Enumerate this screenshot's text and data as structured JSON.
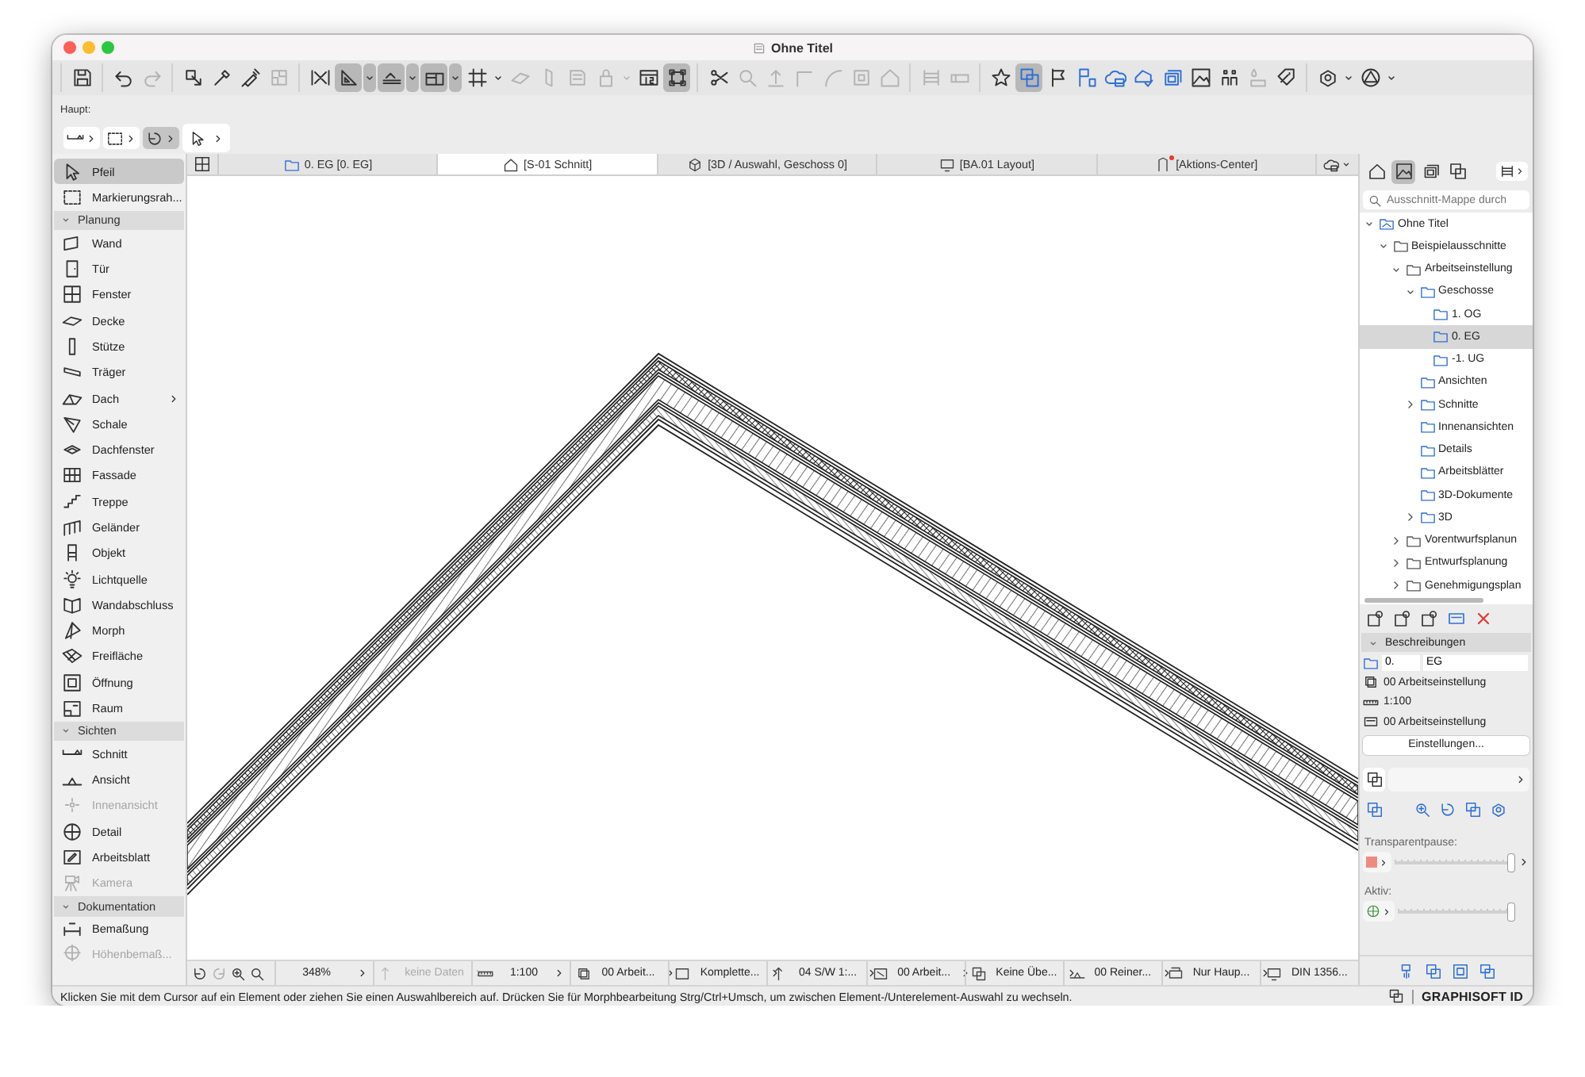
{
  "window": {
    "title": "Ohne Titel"
  },
  "toolbar": [
    {
      "buttons": [
        {
          "kind": "plain",
          "selected": false,
          "disabled": false
        }
      ]
    },
    {
      "buttons": [
        {
          "kind": "plain",
          "selected": false,
          "disabled": false
        },
        {
          "kind": "plain",
          "selected": false,
          "disabled": true
        }
      ]
    },
    {
      "buttons": [
        {
          "kind": "plain",
          "selected": false,
          "disabled": false
        },
        {
          "kind": "plain",
          "selected": false,
          "disabled": false
        },
        {
          "kind": "plain",
          "selected": false,
          "disabled": false
        },
        {
          "kind": "plain",
          "selected": false,
          "disabled": true
        }
      ]
    },
    {
      "buttons": [
        {
          "kind": "plain",
          "selected": false,
          "disabled": false
        },
        {
          "kind": "menu",
          "selected": true,
          "disabled": false
        },
        {
          "kind": "menu",
          "selected": true,
          "disabled": false
        },
        {
          "kind": "menu",
          "selected": true,
          "disabled": false
        },
        {
          "kind": "menu",
          "selected": false,
          "disabled": false
        },
        {
          "kind": "plain",
          "selected": false,
          "disabled": true
        },
        {
          "kind": "plain",
          "selected": false,
          "disabled": true
        },
        {
          "kind": "plain",
          "selected": false,
          "disabled": true
        },
        {
          "kind": "menu",
          "selected": false,
          "disabled": true
        },
        {
          "kind": "plain",
          "selected": false,
          "disabled": false
        },
        {
          "kind": "plain",
          "selected": true,
          "disabled": false
        }
      ]
    },
    {
      "buttons": [
        {
          "kind": "plain",
          "selected": false,
          "disabled": false
        },
        {
          "kind": "plain",
          "selected": false,
          "disabled": true
        },
        {
          "kind": "plain",
          "selected": false,
          "disabled": true
        },
        {
          "kind": "plain",
          "selected": false,
          "disabled": true
        },
        {
          "kind": "plain",
          "selected": false,
          "disabled": true
        },
        {
          "kind": "plain",
          "selected": false,
          "disabled": true
        },
        {
          "kind": "plain",
          "selected": false,
          "disabled": true
        }
      ]
    },
    {
      "buttons": [
        {
          "kind": "plain",
          "selected": false,
          "disabled": true
        },
        {
          "kind": "plain",
          "selected": false,
          "disabled": true
        }
      ]
    },
    {
      "buttons": [
        {
          "kind": "plain",
          "selected": false,
          "disabled": false
        },
        {
          "kind": "plain",
          "selected": true,
          "disabled": false
        },
        {
          "kind": "plain",
          "selected": false,
          "disabled": false
        },
        {
          "kind": "plain",
          "selected": false,
          "disabled": false
        },
        {
          "kind": "plain",
          "selected": false,
          "disabled": false
        },
        {
          "kind": "plain",
          "selected": false,
          "disabled": false
        },
        {
          "kind": "plain",
          "selected": false,
          "disabled": false
        },
        {
          "kind": "plain",
          "selected": false,
          "disabled": false
        },
        {
          "kind": "plain",
          "selected": false,
          "disabled": false
        },
        {
          "kind": "plain",
          "selected": false,
          "disabled": true
        },
        {
          "kind": "plain",
          "selected": false,
          "disabled": false
        }
      ]
    },
    {
      "buttons": [
        {
          "kind": "menu",
          "selected": false,
          "disabled": false
        },
        {
          "kind": "menu",
          "selected": false,
          "disabled": false
        }
      ]
    }
  ],
  "info_box": {
    "label": "Haupt:",
    "buttons": [
      {
        "selected": false
      },
      {
        "selected": false
      },
      {
        "selected": true
      },
      {
        "selected": false
      }
    ]
  },
  "toolbox": [
    {
      "kind": "tool",
      "label": "Pfeil",
      "selected": true,
      "disabled": false
    },
    {
      "kind": "tool",
      "label": "Markierungsrah...",
      "selected": false,
      "disabled": false
    },
    {
      "kind": "header",
      "label": "Planung",
      "expanded": true
    },
    {
      "kind": "tool",
      "label": "Wand",
      "selected": false,
      "disabled": false
    },
    {
      "kind": "tool",
      "label": "Tür",
      "selected": false,
      "disabled": false
    },
    {
      "kind": "tool",
      "label": "Fenster",
      "selected": false,
      "disabled": false
    },
    {
      "kind": "tool",
      "label": "Decke",
      "selected": false,
      "disabled": false
    },
    {
      "kind": "tool",
      "label": "Stütze",
      "selected": false,
      "disabled": false
    },
    {
      "kind": "tool",
      "label": "Träger",
      "selected": false,
      "disabled": false
    },
    {
      "kind": "menu-tool",
      "label": "Dach",
      "selected": false,
      "disabled": false
    },
    {
      "kind": "tool",
      "label": "Schale",
      "selected": false,
      "disabled": false
    },
    {
      "kind": "tool",
      "label": "Dachfenster",
      "selected": false,
      "disabled": false
    },
    {
      "kind": "tool",
      "label": "Fassade",
      "selected": false,
      "disabled": false
    },
    {
      "kind": "tool",
      "label": "Treppe",
      "selected": false,
      "disabled": false
    },
    {
      "kind": "tool",
      "label": "Geländer",
      "selected": false,
      "disabled": false
    },
    {
      "kind": "tool",
      "label": "Objekt",
      "selected": false,
      "disabled": false
    },
    {
      "kind": "tool",
      "label": "Lichtquelle",
      "selected": false,
      "disabled": false
    },
    {
      "kind": "tool",
      "label": "Wandabschluss",
      "selected": false,
      "disabled": false
    },
    {
      "kind": "tool",
      "label": "Morph",
      "selected": false,
      "disabled": false
    },
    {
      "kind": "tool",
      "label": "Freifläche",
      "selected": false,
      "disabled": false
    },
    {
      "kind": "tool",
      "label": "Öffnung",
      "selected": false,
      "disabled": false
    },
    {
      "kind": "tool",
      "label": "Raum",
      "selected": false,
      "disabled": false
    },
    {
      "kind": "header",
      "label": "Sichten",
      "expanded": true
    },
    {
      "kind": "tool",
      "label": "Schnitt",
      "selected": false,
      "disabled": false
    },
    {
      "kind": "tool",
      "label": "Ansicht",
      "selected": false,
      "disabled": false
    },
    {
      "kind": "tool",
      "label": "Innenansicht",
      "selected": false,
      "disabled": true
    },
    {
      "kind": "tool",
      "label": "Detail",
      "selected": false,
      "disabled": false
    },
    {
      "kind": "tool",
      "label": "Arbeitsblatt",
      "selected": false,
      "disabled": false
    },
    {
      "kind": "tool",
      "label": "Kamera",
      "selected": false,
      "disabled": true
    },
    {
      "kind": "header",
      "label": "Dokumentation",
      "expanded": true
    },
    {
      "kind": "tool",
      "label": "Bemaßung",
      "selected": false,
      "disabled": false
    },
    {
      "kind": "tool",
      "label": "Höhenbemaß...",
      "selected": false,
      "disabled": true
    }
  ],
  "tabs": [
    {
      "label": "0. EG [0. EG]",
      "selected": false,
      "alert": false
    },
    {
      "label": "[S-01 Schnitt]",
      "selected": true,
      "alert": false
    },
    {
      "label": "[3D / Auswahl, Geschoss 0]",
      "selected": false,
      "alert": false
    },
    {
      "label": "[BA.01 Layout]",
      "selected": false,
      "alert": false
    },
    {
      "label": "[Aktions-Center]",
      "selected": false,
      "alert": true
    }
  ],
  "navigator": {
    "modes": [
      {
        "selected": false
      },
      {
        "selected": true
      },
      {
        "selected": false
      },
      {
        "selected": false
      }
    ],
    "search": {
      "placeholder": "Ausschnitt-Mappe durch"
    },
    "tree": [
      {
        "label": "Ohne Titel",
        "selected": false,
        "expanded": true,
        "children": [
          {
            "label": "Beispielausschnitte",
            "selected": false,
            "expanded": true,
            "children": [
              {
                "label": "Arbeitseinstellung",
                "selected": false,
                "expanded": true,
                "children": [
                  {
                    "label": "Geschosse",
                    "selected": false,
                    "expanded": true,
                    "children": [
                      {
                        "label": "1. OG",
                        "selected": false
                      },
                      {
                        "label": "0. EG",
                        "selected": true
                      },
                      {
                        "label": "-1. UG",
                        "selected": false
                      }
                    ]
                  },
                  {
                    "label": "Ansichten",
                    "selected": false
                  },
                  {
                    "label": "Schnitte",
                    "selected": false,
                    "expanded": false
                  },
                  {
                    "label": "Innenansichten",
                    "selected": false
                  },
                  {
                    "label": "Details",
                    "selected": false
                  },
                  {
                    "label": "Arbeitsblätter",
                    "selected": false
                  },
                  {
                    "label": "3D-Dokumente",
                    "selected": false
                  },
                  {
                    "label": "3D",
                    "selected": false,
                    "expanded": false
                  }
                ]
              },
              {
                "label": "Vorentwurfsplanun",
                "selected": false,
                "expanded": false
              },
              {
                "label": "Entwurfsplanung",
                "selected": false,
                "expanded": false
              },
              {
                "label": "Genehmigungsplan",
                "selected": false,
                "expanded": false
              }
            ]
          }
        ]
      }
    ],
    "properties": {
      "title": "Beschreibungen",
      "expanded": true,
      "id": "0.",
      "name": "EG",
      "rows": [
        {
          "text": "00 Arbeitseinstellung"
        },
        {
          "text": "1:100"
        },
        {
          "text": "00 Arbeitseinstellung"
        }
      ],
      "button": "Einstellungen..."
    },
    "trace": {
      "label": "Transparentpause:",
      "level": 1
    },
    "active": {
      "label": "Aktiv:",
      "level": 1
    }
  },
  "status_bar": {
    "zoom": "348%",
    "items": [
      {
        "label": "keine Daten",
        "disabled": true
      },
      {
        "label": "1:100",
        "disabled": false
      },
      {
        "label": "00 Arbeit...",
        "disabled": false
      },
      {
        "label": "Komplette...",
        "disabled": false
      },
      {
        "label": "04 S/W 1:...",
        "disabled": false
      },
      {
        "label": "00 Arbeit...",
        "disabled": false
      },
      {
        "label": "Keine Übe...",
        "disabled": false
      },
      {
        "label": "00 Reiner...",
        "disabled": false
      },
      {
        "label": "Nur Haup...",
        "disabled": false
      },
      {
        "label": "DIN 1356...",
        "disabled": false
      }
    ]
  },
  "message_bar": {
    "text": "Klicken Sie mit dem Cursor auf ein Element oder ziehen Sie einen Auswahlbereich auf. Drücken Sie für Morphbearbeitung Strg/Ctrl+Umsch, um zwischen Element-/Unterelement-Auswahl zu wechseln.",
    "brand": "GRAPHISOFT ID"
  }
}
